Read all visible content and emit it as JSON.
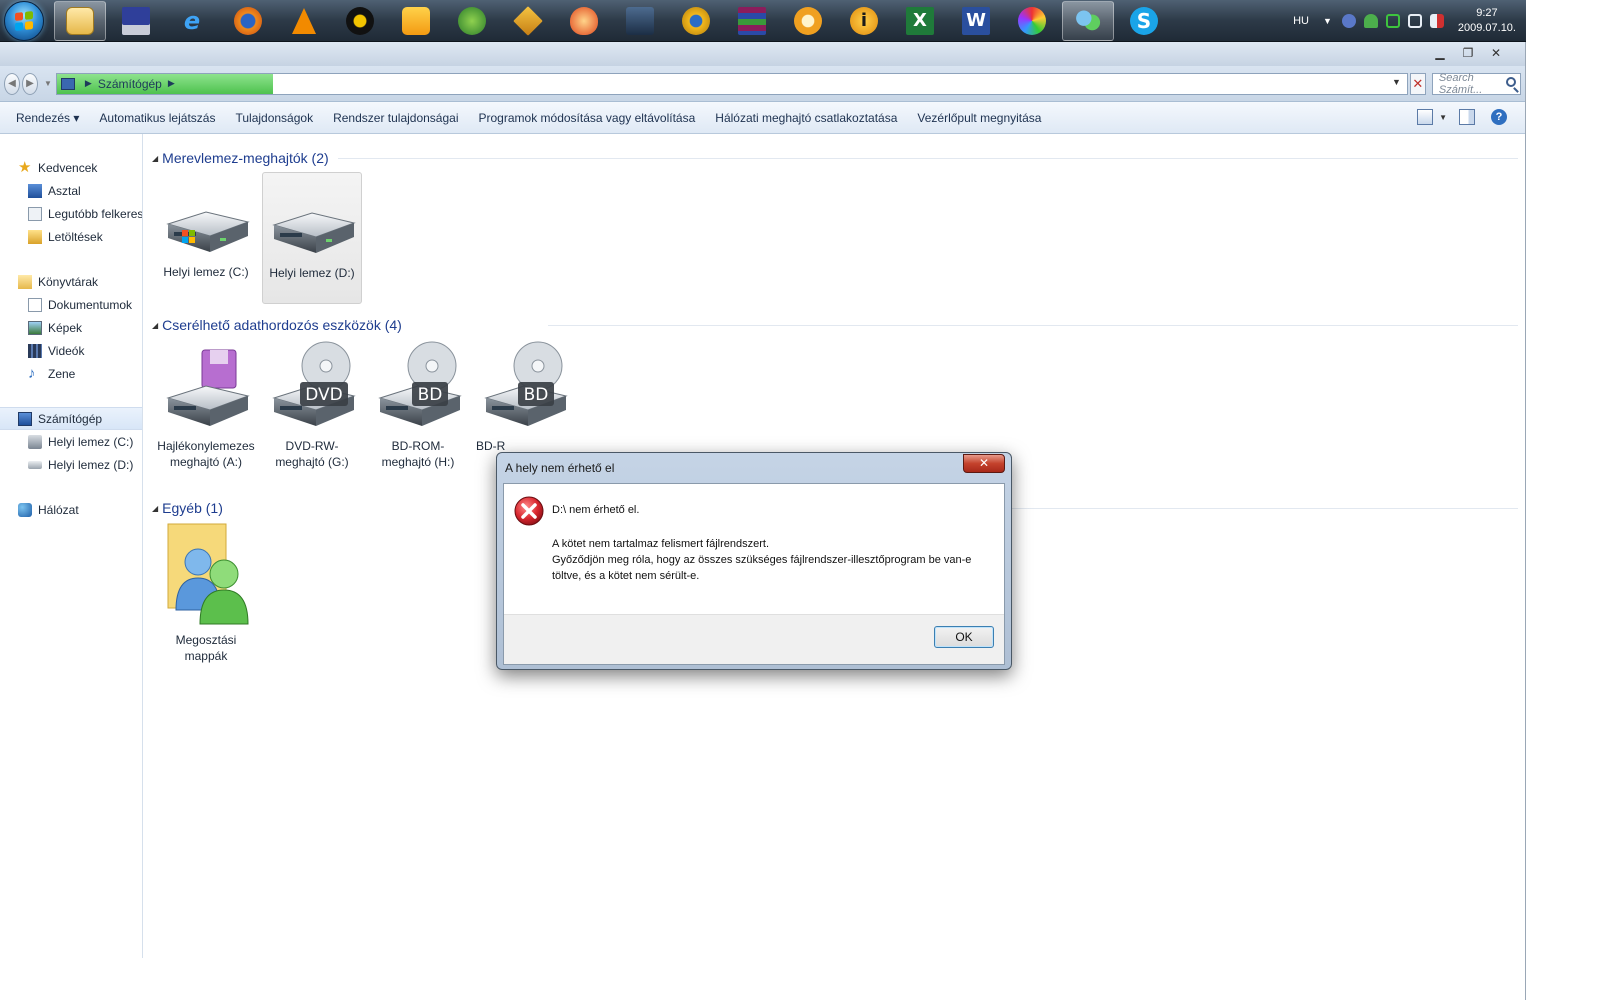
{
  "taskbar": {
    "icons": [
      "explorer-icon",
      "floppy-save-icon",
      "internet-explorer-icon",
      "firefox-icon",
      "vlc-icon",
      "media-player-icon",
      "video-player-icon",
      "windows-flag-icon",
      "pen-tool-icon",
      "nero-burn-icon",
      "install-icon",
      "settings-gear-icon",
      "winrar-icon",
      "rss-reader-icon",
      "info-icon",
      "excel-icon",
      "word-icon",
      "paint-icon",
      "messenger-icon",
      "skype-icon"
    ],
    "tray_lang": "HU",
    "time": "9:27",
    "date": "2009.07.10."
  },
  "address": {
    "location": "Számítógép",
    "load_progress": 0.16,
    "search_placeholder": "Search Számít..."
  },
  "commands": [
    "Rendezés ▾",
    "Automatikus lejátszás",
    "Tulajdonságok",
    "Rendszer tulajdonságai",
    "Programok módosítása vagy eltávolítása",
    "Hálózati meghajtó csatlakoztatása",
    "Vezérlőpult megnyitása"
  ],
  "sidebar": {
    "favorites": "Kedvencek",
    "favorites_items": [
      "Asztal",
      "Legutóbb felkeresett",
      "Letöltések"
    ],
    "libraries": "Könyvtárak",
    "libraries_items": [
      "Dokumentumok",
      "Képek",
      "Videók",
      "Zene"
    ],
    "computer": "Számítógép",
    "computer_items": [
      "Helyi lemez (C:)",
      "Helyi lemez (D:)"
    ],
    "network": "Hálózat"
  },
  "sections": {
    "hard_drives": "Merevlemez-meghajtók (2)",
    "removable": "Cserélhető adathordozós eszközök (4)",
    "other": "Egyéb (1)"
  },
  "items": {
    "drive_c": "Helyi lemez (C:)",
    "drive_d": "Helyi lemez (D:)",
    "floppy": "Hajlékonylemezes meghajtó (A:)",
    "dvd": "DVD-RW-meghajtó (G:)",
    "bd1": "BD-ROM-meghajtó (H:)",
    "bd2": "BD-R",
    "shared": "Megosztási mappák",
    "dvd_badge": "DVD",
    "bd_badge": "BD"
  },
  "dialog": {
    "title": "A hely nem érhető el",
    "close": "✕",
    "main": "D:\\ nem érhető el.",
    "line1": "A kötet nem tartalmaz felismert fájlrendszert.",
    "line2": "Győződjön meg róla, hogy az összes szükséges fájlrendszer-illesztőprogram be van-e töltve, és a kötet nem sérült-e.",
    "ok": "OK"
  },
  "colors": {
    "taskbar": "#2d3a48",
    "accent_blue": "#1e3d8f",
    "error_red": "#c4202a"
  }
}
